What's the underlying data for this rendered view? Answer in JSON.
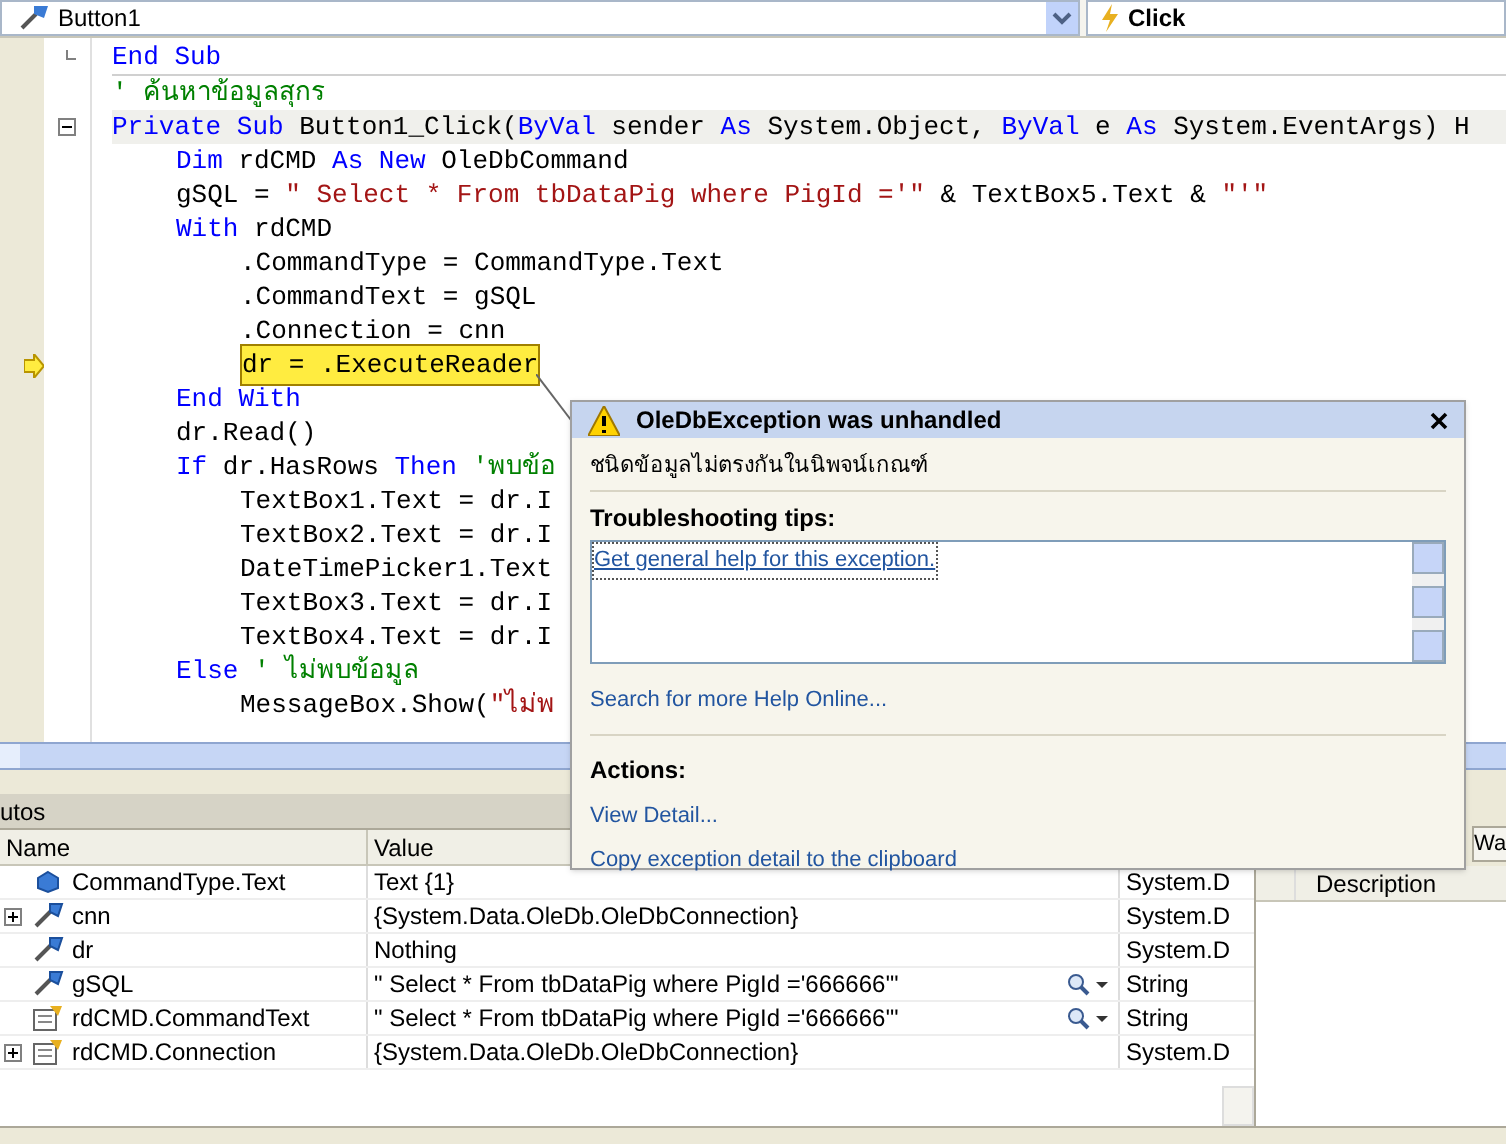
{
  "navbar": {
    "object": "Button1",
    "event": "Click"
  },
  "code": {
    "lines": [
      {
        "block_end": true,
        "collapsible": false,
        "current": false,
        "segments": [
          {
            "kind": "keyword",
            "text": "End Sub"
          }
        ]
      },
      {
        "block_end": false,
        "collapsible": false,
        "current": false,
        "segments": [
          {
            "kind": "comment",
            "text": "' ค้นหาข้อมูลสุกร"
          }
        ]
      },
      {
        "block_end": false,
        "collapsible": true,
        "current": false,
        "segments": [
          {
            "kind": "keyword",
            "text": "Private Sub"
          },
          {
            "kind": "plain",
            "text": " Button1_Click("
          },
          {
            "kind": "keyword",
            "text": "ByVal"
          },
          {
            "kind": "plain",
            "text": " sender "
          },
          {
            "kind": "keyword",
            "text": "As"
          },
          {
            "kind": "plain",
            "text": " System.Object, "
          },
          {
            "kind": "keyword",
            "text": "ByVal"
          },
          {
            "kind": "plain",
            "text": " e "
          },
          {
            "kind": "keyword",
            "text": "As"
          },
          {
            "kind": "plain",
            "text": " System.EventArgs) H"
          }
        ],
        "children": [
          {
            "block_end": false,
            "collapsible": false,
            "current": false,
            "segments": [
              {
                "kind": "keyword",
                "text": "Dim"
              },
              {
                "kind": "plain",
                "text": " rdCMD "
              },
              {
                "kind": "keyword",
                "text": "As New"
              },
              {
                "kind": "plain",
                "text": " OleDbCommand"
              }
            ]
          },
          {
            "block_end": false,
            "collapsible": false,
            "current": false,
            "segments": [
              {
                "kind": "plain",
                "text": "gSQL = "
              },
              {
                "kind": "string",
                "text": "\" Select * From tbDataPig where PigId ='\""
              },
              {
                "kind": "plain",
                "text": " & TextBox5.Text & "
              },
              {
                "kind": "string",
                "text": "\"'\""
              }
            ]
          },
          {
            "block_end": false,
            "collapsible": false,
            "current": false,
            "segments": [
              {
                "kind": "keyword",
                "text": "With"
              },
              {
                "kind": "plain",
                "text": " rdCMD"
              }
            ],
            "children": [
              {
                "block_end": false,
                "collapsible": false,
                "current": false,
                "segments": [
                  {
                    "kind": "plain",
                    "text": ".CommandType = CommandType.Text"
                  }
                ]
              },
              {
                "block_end": false,
                "collapsible": false,
                "current": false,
                "segments": [
                  {
                    "kind": "plain",
                    "text": ".CommandText = gSQL"
                  }
                ]
              },
              {
                "block_end": false,
                "collapsible": false,
                "current": false,
                "segments": [
                  {
                    "kind": "plain",
                    "text": ".Connection = cnn"
                  }
                ]
              },
              {
                "block_end": false,
                "collapsible": false,
                "current": true,
                "segments": [
                  {
                    "kind": "plain",
                    "text": "dr = .ExecuteReader"
                  }
                ]
              }
            ]
          },
          {
            "block_end": false,
            "collapsible": false,
            "current": false,
            "segments": [
              {
                "kind": "keyword",
                "text": "End With"
              }
            ]
          },
          {
            "block_end": false,
            "collapsible": false,
            "current": false,
            "segments": [
              {
                "kind": "plain",
                "text": "dr.Read()"
              }
            ]
          },
          {
            "block_end": false,
            "collapsible": false,
            "current": false,
            "segments": [
              {
                "kind": "keyword",
                "text": "If"
              },
              {
                "kind": "plain",
                "text": " dr.HasRows "
              },
              {
                "kind": "keyword",
                "text": "Then"
              },
              {
                "kind": "comment",
                "text": " 'พบข้อ"
              }
            ],
            "children": [
              {
                "block_end": false,
                "collapsible": false,
                "current": false,
                "segments": [
                  {
                    "kind": "plain",
                    "text": "TextBox1.Text = dr.I"
                  }
                ]
              },
              {
                "block_end": false,
                "collapsible": false,
                "current": false,
                "segments": [
                  {
                    "kind": "plain",
                    "text": "TextBox2.Text = dr.I"
                  }
                ]
              },
              {
                "block_end": false,
                "collapsible": false,
                "current": false,
                "segments": [
                  {
                    "kind": "plain",
                    "text": "DateTimePicker1.Text"
                  }
                ]
              },
              {
                "block_end": false,
                "collapsible": false,
                "current": false,
                "segments": [
                  {
                    "kind": "plain",
                    "text": "TextBox3.Text = dr.I"
                  }
                ]
              },
              {
                "block_end": false,
                "collapsible": false,
                "current": false,
                "segments": [
                  {
                    "kind": "plain",
                    "text": "TextBox4.Text = dr.I"
                  }
                ]
              }
            ]
          },
          {
            "block_end": false,
            "collapsible": false,
            "current": false,
            "segments": [
              {
                "kind": "keyword",
                "text": "Else"
              },
              {
                "kind": "comment",
                "text": " ' ไม่พบข้อมูล"
              }
            ],
            "children": [
              {
                "block_end": false,
                "collapsible": false,
                "current": false,
                "segments": [
                  {
                    "kind": "plain",
                    "text": "MessageBox.Show("
                  },
                  {
                    "kind": "string",
                    "text": "\"ไม่พ"
                  }
                ]
              }
            ]
          }
        ]
      }
    ]
  },
  "exception": {
    "title": "OleDbException was unhandled",
    "message": "ชนิดข้อมูลไม่ตรงกันในนิพจน์เกณฑ์",
    "tips_heading": "Troubleshooting tips:",
    "tips": [
      "Get general help for this exception."
    ],
    "search_link": "Search for more Help Online...",
    "actions_heading": "Actions:",
    "actions": [
      "View Detail...",
      "Copy exception detail to the clipboard"
    ]
  },
  "autos": {
    "title": "utos",
    "columns": [
      "Name",
      "Value"
    ],
    "rows": [
      {
        "kind": "field",
        "expandable": false,
        "name": "CommandType.Text",
        "value": "Text {1}",
        "visualizer": false,
        "type": "System.D"
      },
      {
        "kind": "variable",
        "expandable": true,
        "name": "cnn",
        "value": "{System.Data.OleDb.OleDbConnection}",
        "visualizer": false,
        "type": "System.D"
      },
      {
        "kind": "variable",
        "expandable": false,
        "name": "dr",
        "value": "Nothing",
        "visualizer": false,
        "type": "System.D"
      },
      {
        "kind": "variable",
        "expandable": false,
        "name": "gSQL",
        "value": "\" Select * From tbDataPig where PigId ='666666'\"",
        "visualizer": true,
        "type": "String"
      },
      {
        "kind": "property",
        "expandable": false,
        "name": "rdCMD.CommandText",
        "value": "\" Select * From tbDataPig where PigId ='666666'\"",
        "visualizer": true,
        "type": "String"
      },
      {
        "kind": "property",
        "expandable": true,
        "name": "rdCMD.Connection",
        "value": "{System.Data.OleDb.OleDbConnection}",
        "visualizer": false,
        "type": "System.D"
      }
    ]
  },
  "side_panel": {
    "tab": "Wa",
    "column": "Description"
  }
}
